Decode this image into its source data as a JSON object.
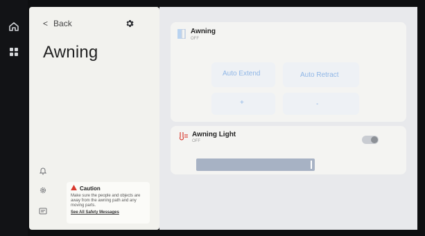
{
  "nav": {
    "back_label": "Back",
    "title": "Awning"
  },
  "caution": {
    "title": "Caution",
    "body": "Make sure the people and objects are away from the awning path and any moving parts.",
    "link": "See All Safety Messages"
  },
  "awning_card": {
    "title": "Awning",
    "status": "OFF",
    "auto_extend": "Auto Extend",
    "auto_retract": "Auto Retract",
    "plus": "+",
    "minus": "-"
  },
  "light_card": {
    "title": "Awning Light",
    "status": "OFF",
    "toggle_on": false,
    "brightness_level": 0.97
  },
  "colors": {
    "accent_blue": "#8fb6e6",
    "caution_red": "#d83a2f",
    "panel": "#f2f2ee",
    "content_bg": "#e8e9ec"
  },
  "icons": [
    "home-icon",
    "grid-icon",
    "bell-icon",
    "settings-gear-icon",
    "message-icon",
    "gear-icon",
    "chevron-left-icon",
    "warning-icon",
    "awning-icon",
    "light-icon"
  ]
}
